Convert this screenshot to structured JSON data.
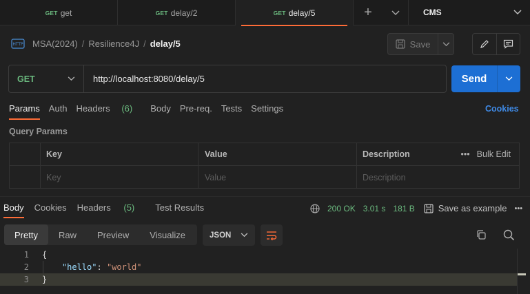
{
  "tabs": [
    {
      "method": "GET",
      "label": "get"
    },
    {
      "method": "GET",
      "label": "delay/2"
    },
    {
      "method": "GET",
      "label": "delay/5"
    }
  ],
  "environment": "CMS",
  "breadcrumb": {
    "workspace": "MSA(2024)",
    "collection": "Resilience4J",
    "current": "delay/5"
  },
  "save_label": "Save",
  "request": {
    "method": "GET",
    "url": "http://localhost:8080/delay/5",
    "send_label": "Send"
  },
  "request_tabs": {
    "params": "Params",
    "auth": "Auth",
    "headers": "Headers",
    "headers_count": "(6)",
    "body": "Body",
    "prereq": "Pre-req.",
    "tests": "Tests",
    "settings": "Settings",
    "cookies": "Cookies"
  },
  "query_params": {
    "title": "Query Params",
    "columns": {
      "key": "Key",
      "value": "Value",
      "description": "Description"
    },
    "bulk_edit": "Bulk Edit",
    "placeholders": {
      "key": "Key",
      "value": "Value",
      "description": "Description"
    }
  },
  "response_tabs": {
    "body": "Body",
    "cookies": "Cookies",
    "headers": "Headers",
    "headers_count": "(5)",
    "test_results": "Test Results"
  },
  "response_status": {
    "status": "200 OK",
    "time": "3.01 s",
    "size": "181 B",
    "save_example": "Save as example"
  },
  "format_tabs": {
    "pretty": "Pretty",
    "raw": "Raw",
    "preview": "Preview",
    "visualize": "Visualize"
  },
  "format_select": "JSON",
  "code_lines": [
    {
      "num": "1",
      "text": "{"
    },
    {
      "num": "2",
      "key": "\"hello\"",
      "colon": ": ",
      "value": "\"world\""
    },
    {
      "num": "3",
      "text": "}"
    }
  ],
  "colors": {
    "accent": "#ff6c37",
    "send": "#1d6fd4",
    "get_method": "#6bba7f",
    "link": "#3f8ae6"
  }
}
